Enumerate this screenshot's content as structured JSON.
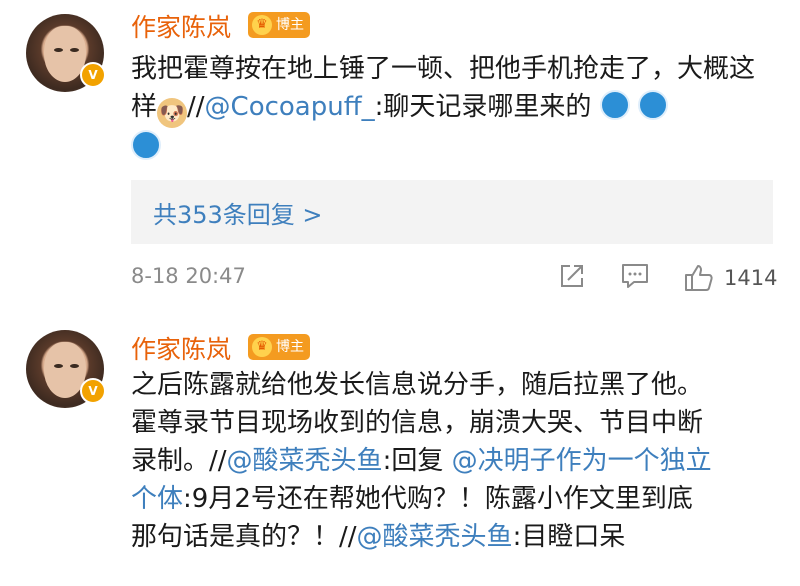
{
  "comments": [
    {
      "author": "作家陈岚",
      "badge": "博主",
      "text_main": "我把霍尊按在地上锤了一顿、把他手机抢走了，大概这样",
      "repost_prefix": "//",
      "mention": "@Cocoapuff_",
      "repost_text": ":聊天记录哪里来的",
      "replies_label": "共353条回复 >",
      "timestamp": "8-18 20:47",
      "like_count": "1414"
    },
    {
      "author": "作家陈岚",
      "badge": "博主",
      "line1": "之后陈露就给他发长信息说分手，随后拉黑了他。",
      "line2": "霍尊录节目现场收到的信息，崩溃大哭、节目中断",
      "line3_a": "录制。",
      "slash1": "//",
      "mention1": "@酸菜秃头鱼",
      "reply_text": ":回复",
      "mention2": "@决明子作为一个独立",
      "line4_a": "个体",
      "line4_b": ":9月2号还在帮她代购？！陈露小作文里到底",
      "line5_a": "那句话是真的？！",
      "slash2": "//",
      "mention3": "@酸菜秃头鱼",
      "line5_b": ":目瞪口呆"
    }
  ],
  "icons": [
    "verified-v-icon",
    "blogger-crown-icon",
    "doge-emoji-icon",
    "doraemon-emoji-icon",
    "share-icon",
    "comment-icon",
    "like-icon"
  ],
  "colors": {
    "author": "#e8620a",
    "link": "#3e7fbd",
    "badge": "#f49b20",
    "meta": "#8a8a8a",
    "reply_bg": "#f3f3f3"
  }
}
